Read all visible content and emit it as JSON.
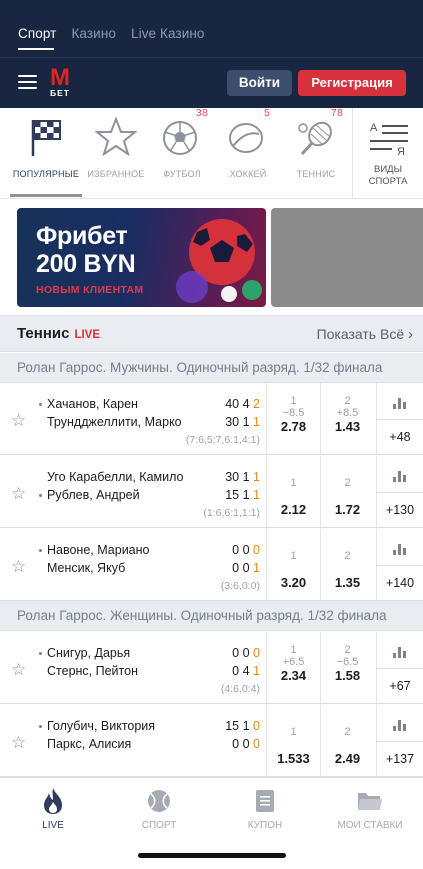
{
  "top_tabs": [
    "Спорт",
    "Казино",
    "Live Казино"
  ],
  "logo": {
    "letter": "M",
    "word": "БЕТ"
  },
  "login_label": "Войти",
  "register_label": "Регистрация",
  "sports": [
    {
      "label": "Популярные",
      "count": "",
      "icon": "flag-icon"
    },
    {
      "label": "Избранное",
      "count": "",
      "icon": "star-icon"
    },
    {
      "label": "Футбол",
      "count": "38",
      "icon": "soccer-ball-icon"
    },
    {
      "label": "Хоккей",
      "count": "5",
      "icon": "hockey-puck-icon"
    },
    {
      "label": "Теннис",
      "count": "78",
      "icon": "tennis-racket-icon"
    }
  ],
  "all_sports": {
    "az_top": "А",
    "az_bottom": "Я",
    "label1": "Виды",
    "label2": "спорта"
  },
  "banner": {
    "line1": "Фрибет",
    "line2": "200 BYN",
    "line3": "НОВЫМ КЛИЕНТАМ"
  },
  "section": {
    "title": "Теннис",
    "live": "LIVE",
    "show_all": "Показать Всё"
  },
  "tournaments": [
    {
      "name": "Ролан Гаррос. Мужчины. Одиночный разряд. 1/32 финала",
      "matches": [
        {
          "p1": "Хачанов, Карен",
          "p2": "Трундджеллити, Марко",
          "serve": 1,
          "s1": [
            "40",
            "4",
            "2"
          ],
          "s2": [
            "30",
            "1",
            "1"
          ],
          "sets": "(7:6,5:7,6:1,4:1)",
          "h1": "−8.5",
          "h2": "+8.5",
          "o1": "2.78",
          "o2": "1.43",
          "more": "+48"
        },
        {
          "p1": "Уго Карабелли, Камило",
          "p2": "Рублев, Андрей",
          "serve": 2,
          "s1": [
            "30",
            "1",
            "1"
          ],
          "s2": [
            "15",
            "1",
            "1"
          ],
          "sets": "(1:6,6:1,1:1)",
          "h1": "",
          "h2": "",
          "o1": "2.12",
          "o2": "1.72",
          "more": "+130"
        },
        {
          "p1": "Навоне, Мариано",
          "p2": "Менсик, Якуб",
          "serve": 1,
          "s1": [
            "0",
            "0",
            "0"
          ],
          "s2": [
            "0",
            "0",
            "1"
          ],
          "sets": "(3:6,0:0)",
          "h1": "",
          "h2": "",
          "o1": "3.20",
          "o2": "1.35",
          "more": "+140"
        }
      ]
    },
    {
      "name": "Ролан Гаррос. Женщины. Одиночный разряд. 1/32 финала",
      "matches": [
        {
          "p1": "Снигур, Дарья",
          "p2": "Стернс, Пейтон",
          "serve": 1,
          "s1": [
            "0",
            "0",
            "0"
          ],
          "s2": [
            "0",
            "4",
            "1"
          ],
          "sets": "(4:6,0:4)",
          "h1": "+6.5",
          "h2": "−6.5",
          "o1": "2.34",
          "o2": "1.58",
          "more": "+67"
        },
        {
          "p1": "Голубич, Виктория",
          "p2": "Паркс, Алисия",
          "serve": 1,
          "s1": [
            "15",
            "1",
            "0"
          ],
          "s2": [
            "0",
            "0",
            "0"
          ],
          "sets": "",
          "h1": "",
          "h2": "",
          "o1": "1.533",
          "o2": "2.49",
          "more": "+137"
        }
      ]
    }
  ],
  "odd_headers": [
    "1",
    "2"
  ],
  "bottom_nav": [
    {
      "label": "Live",
      "icon": "flame-icon"
    },
    {
      "label": "Спорт",
      "icon": "ball-icon"
    },
    {
      "label": "Купон",
      "icon": "coupon-icon"
    },
    {
      "label": "Мои ставки",
      "icon": "folder-icon"
    }
  ],
  "colors": {
    "navy": "#182642",
    "brand_red": "#d7323b",
    "live_red": "#e02c35",
    "score_orange": "#e28b17"
  }
}
